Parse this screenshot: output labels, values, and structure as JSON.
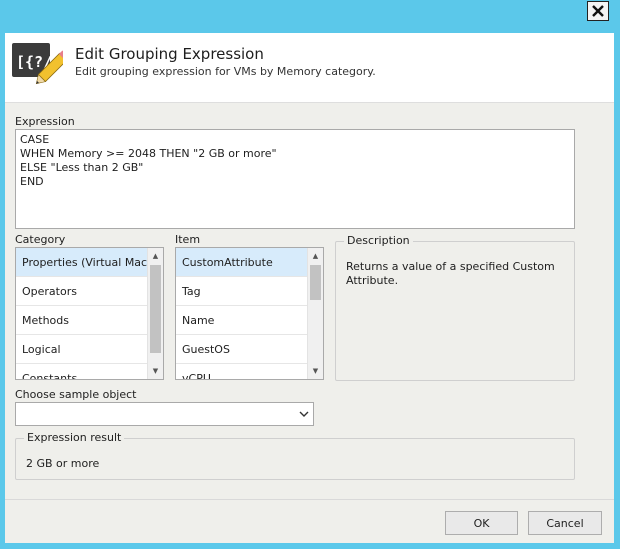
{
  "dialog": {
    "title": "Edit Grouping Expression",
    "subtitle": "Edit grouping expression for VMs by Memory category."
  },
  "expression": {
    "label": "Expression",
    "lines": [
      "CASE",
      "WHEN Memory >= 2048 THEN \"2 GB or more\"",
      "ELSE \"Less than 2 GB\"",
      "END"
    ]
  },
  "category": {
    "label": "Category",
    "items": [
      "Properties (Virtual Machine)",
      "Operators",
      "Methods",
      "Logical",
      "Constants"
    ],
    "selected_index": 0
  },
  "item": {
    "label": "Item",
    "items": [
      "CustomAttribute",
      "Tag",
      "Name",
      "GuestOS",
      "vCPU"
    ],
    "selected_index": 0
  },
  "description": {
    "label": "Description",
    "text": "Returns a value of a specified Custom Attribute."
  },
  "sample": {
    "label": "Choose sample object",
    "value": ""
  },
  "result": {
    "label": "Expression result",
    "value": "2 GB or more"
  },
  "buttons": {
    "ok": "OK",
    "cancel": "Cancel"
  },
  "icons": {
    "close": "close-icon",
    "header": "expression-pencil-icon",
    "dropdown": "chevron-down-icon"
  },
  "colors": {
    "title_bar": "#5bc8ea",
    "selection": "#d7ebfb",
    "window_bg": "#efefeb"
  }
}
